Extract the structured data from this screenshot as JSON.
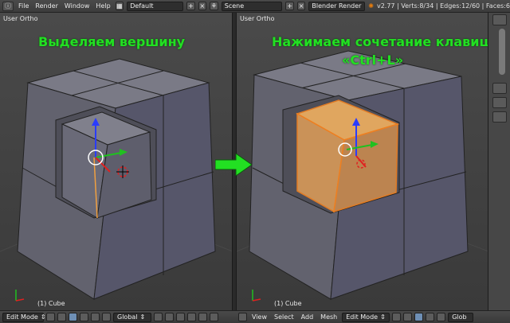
{
  "topbar": {
    "menus": [
      "File",
      "Render",
      "Window",
      "Help"
    ],
    "screen_layout": "Default",
    "scene": "Scene",
    "render_engine": "Blender Render",
    "stats": "v2.77 | Verts:8/34 | Edges:12/60 | Faces:6"
  },
  "viewports": {
    "left": {
      "label": "User Ortho",
      "caption": "Выделяем вершину",
      "object": "(1) Cube"
    },
    "right": {
      "label": "User Ortho",
      "caption_line1": "Нажимаем сочетание клавиш",
      "caption_line2": "«Ctrl+L»",
      "object": "(1) Cube"
    }
  },
  "bottombar": {
    "left": {
      "mode": "Edit Mode",
      "orientation": "Global"
    },
    "right": {
      "menus": [
        "View",
        "Select",
        "Add",
        "Mesh"
      ],
      "mode": "Edit Mode",
      "orientation": "Glob"
    }
  },
  "colors": {
    "caption": "#22e022",
    "selection": "#f0a040",
    "face_light": "#6a6a78",
    "face_dark": "#5a5a66",
    "viewport_bg": "#3d3d3d"
  }
}
